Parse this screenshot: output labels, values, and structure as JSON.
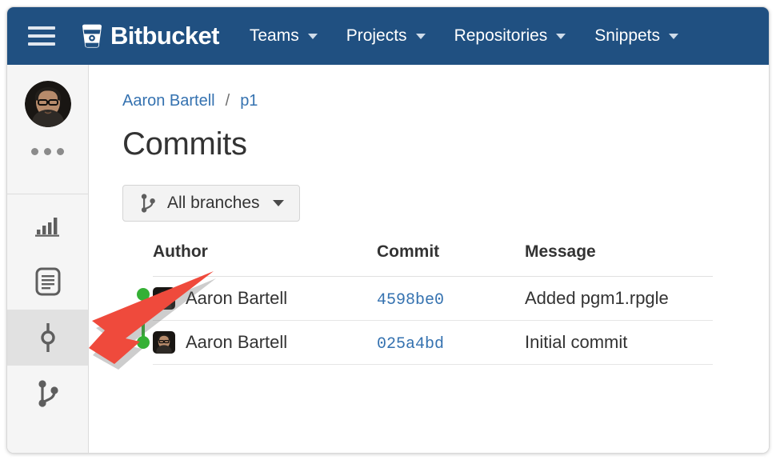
{
  "header": {
    "menu_icon": "hamburger-menu-icon",
    "brand": "Bitbucket",
    "brand_logo_icon": "bitbucket-bucket-logo-icon",
    "nav": [
      {
        "label": "Teams",
        "icon": "chevron-down-icon"
      },
      {
        "label": "Projects",
        "icon": "chevron-down-icon"
      },
      {
        "label": "Repositories",
        "icon": "chevron-down-icon"
      },
      {
        "label": "Snippets",
        "icon": "chevron-down-icon"
      }
    ],
    "background_color": "#205081"
  },
  "sidebar": {
    "avatar": "user-avatar-photo",
    "more_icon": "ellipsis-more-icon",
    "items": [
      {
        "name": "overview",
        "icon": "bar-chart-icon",
        "selected": false
      },
      {
        "name": "source",
        "icon": "document-source-icon",
        "selected": false
      },
      {
        "name": "commits",
        "icon": "commits-node-icon",
        "selected": true
      },
      {
        "name": "branches",
        "icon": "branch-fork-icon",
        "selected": false
      }
    ]
  },
  "breadcrumb": {
    "owner": "Aaron Bartell",
    "separator": "/",
    "repo": "p1"
  },
  "page": {
    "title": "Commits"
  },
  "toolbar": {
    "branch_filter_label": "All branches",
    "branch_filter_icon": "branch-fork-icon",
    "branch_filter_caret": "chevron-down-icon"
  },
  "table": {
    "columns": [
      "Author",
      "Commit",
      "Message"
    ],
    "rows": [
      {
        "author": "Aaron Bartell",
        "author_avatar": "user-avatar-photo",
        "commit": "4598be0",
        "message": "Added pgm1.rpgle",
        "graph_dot_color": "#35b035"
      },
      {
        "author": "Aaron Bartell",
        "author_avatar": "user-avatar-photo",
        "commit": "025a4bd",
        "message": "Initial commit",
        "graph_dot_color": "#35b035"
      }
    ]
  },
  "annotation": {
    "arrow_icon": "red-pointer-arrow-icon",
    "arrow_color": "#ef4a3c",
    "points_to": "sidebar-item-commits"
  },
  "colors": {
    "header_blue": "#205081",
    "link_blue": "#3572b0",
    "graph_green": "#35b035",
    "sidebar_bg": "#f5f5f5",
    "selected_bg": "#e1e1e1"
  }
}
